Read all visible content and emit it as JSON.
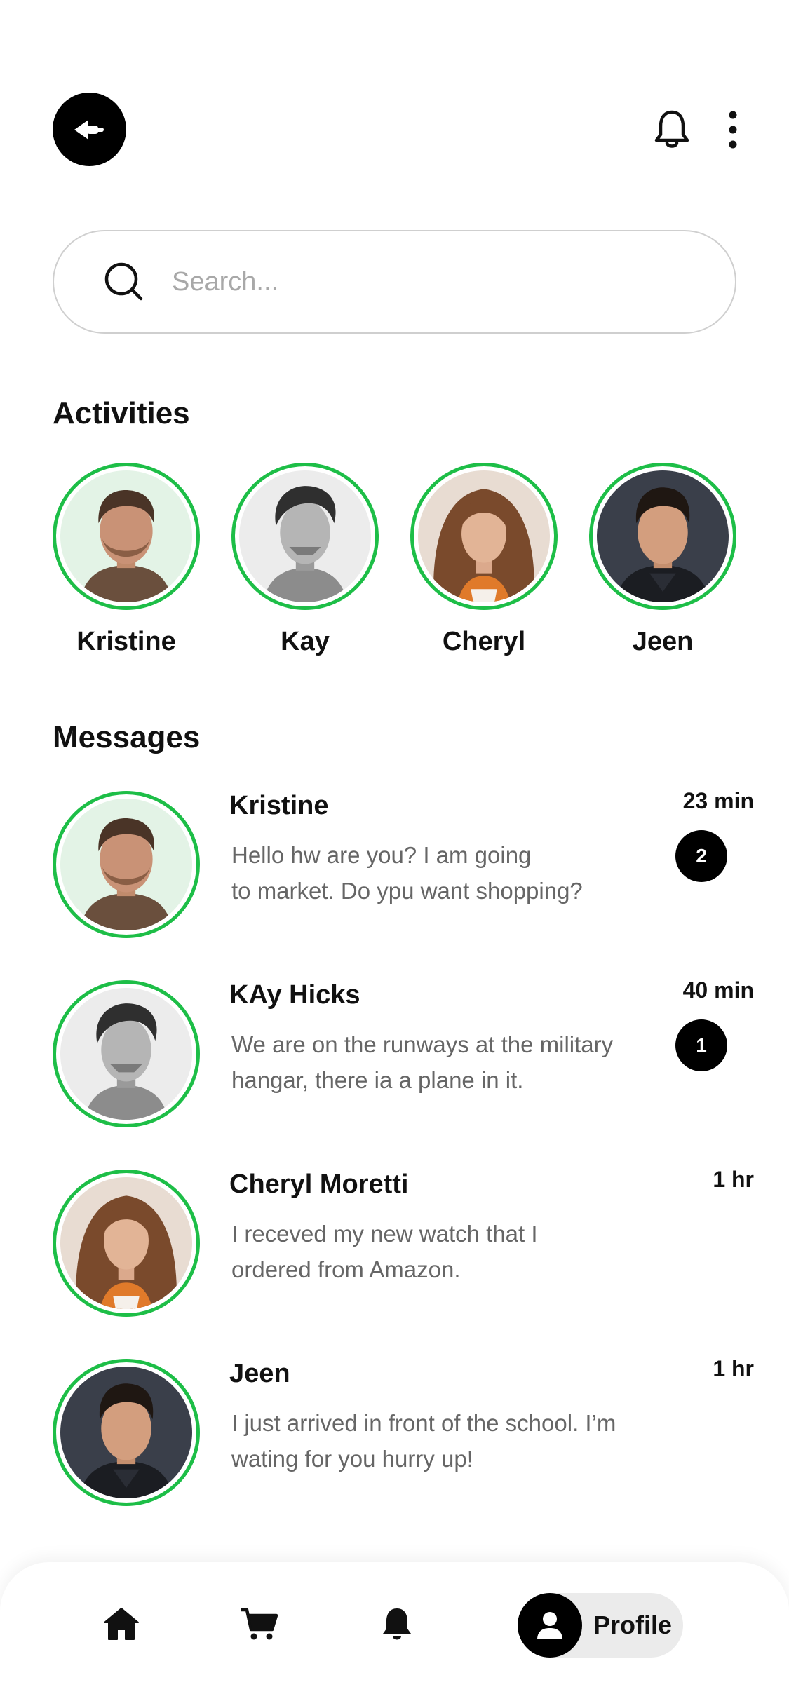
{
  "header": {
    "back_icon": "back-arrow-icon",
    "notification_icon": "bell-icon",
    "more_icon": "more-vertical-icon"
  },
  "search": {
    "placeholder": "Search...",
    "icon": "search-icon"
  },
  "activities": {
    "title": "Activities",
    "items": [
      {
        "name": "Kristine"
      },
      {
        "name": "Kay"
      },
      {
        "name": "Cheryl"
      },
      {
        "name": "Jeen"
      }
    ]
  },
  "messages": {
    "title": "Messages",
    "items": [
      {
        "name": "Kristine",
        "time": "23 min",
        "unread": "2",
        "line1": "Hello hw are you? I am going",
        "line2": "to market. Do ypu want shopping?"
      },
      {
        "name": "KAy Hicks",
        "time": "40 min",
        "unread": "1",
        "line1": "We are on the runways at the military",
        "line2": "hangar, there ia a plane in it."
      },
      {
        "name": "Cheryl Moretti",
        "time": "1 hr",
        "unread": "",
        "line1": "I receved my new watch that I",
        "line2": "ordered from Amazon."
      },
      {
        "name": "Jeen",
        "time": "1 hr",
        "unread": "",
        "line1": "I just arrived in front of the school. I’m",
        "line2": "wating for you hurry up!"
      }
    ]
  },
  "bottom_nav": {
    "items": [
      {
        "icon": "home-icon"
      },
      {
        "icon": "cart-icon"
      },
      {
        "icon": "bell-icon"
      }
    ],
    "profile_label": "Profile",
    "profile_icon": "user-icon"
  },
  "colors": {
    "accent": "#1dbe47",
    "primary": "#000000",
    "muted_text": "#666666",
    "pill_bg": "#ebebeb"
  }
}
